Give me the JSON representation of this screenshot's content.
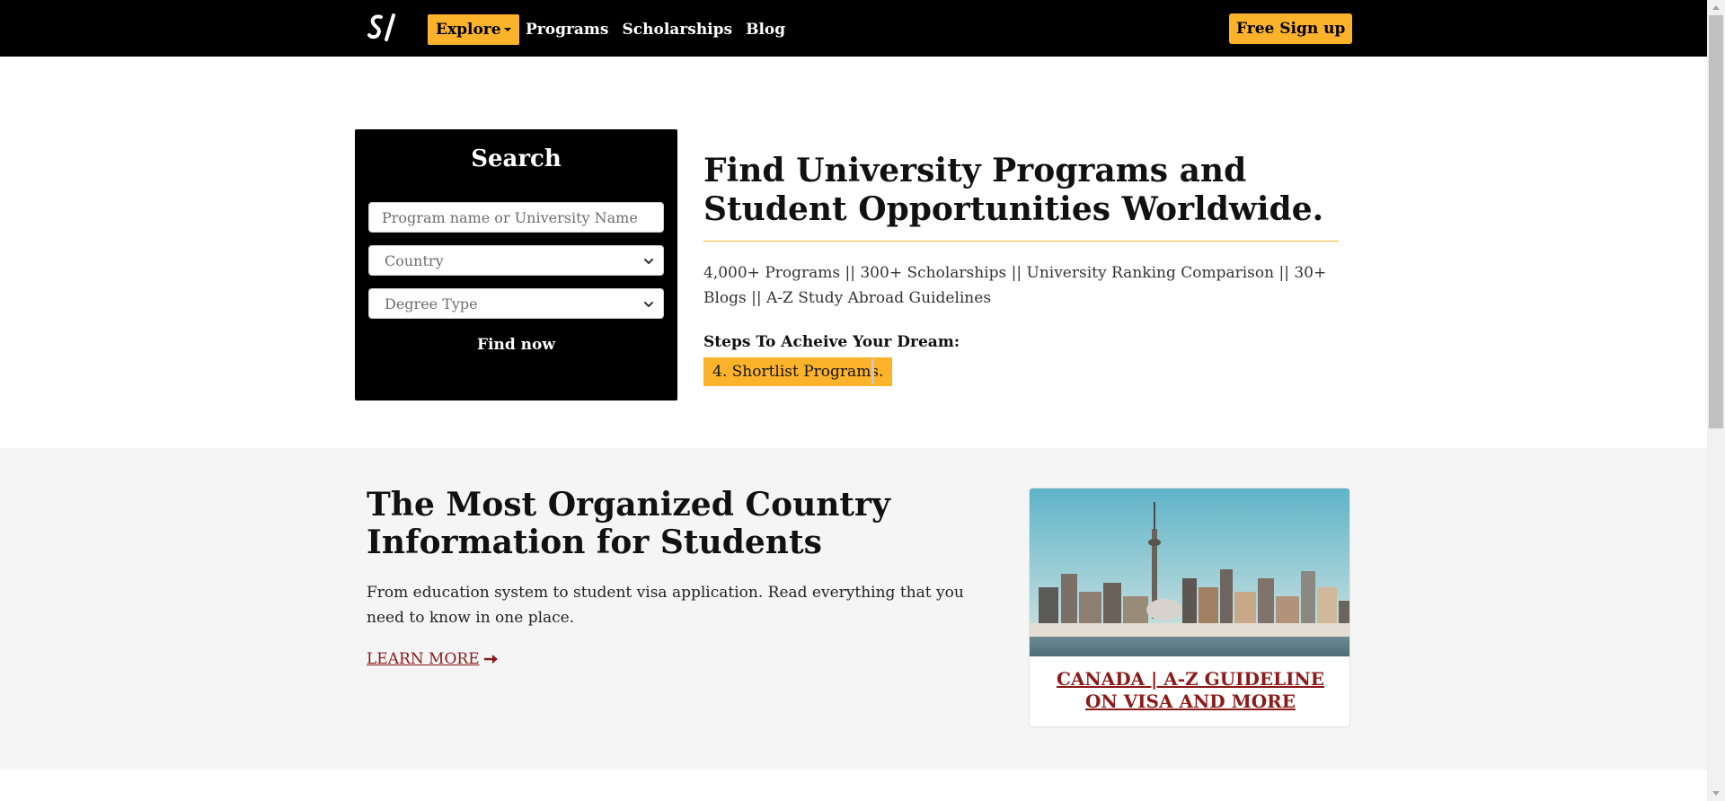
{
  "navbar": {
    "brand": "SI",
    "explore_label": "Explore",
    "links": [
      "Programs",
      "Scholarships",
      "Blog"
    ],
    "signup_label": "Free Sign up"
  },
  "search": {
    "title": "Search",
    "program_placeholder": "Program name or University Name",
    "country_value": "Country",
    "degree_value": "Degree Type",
    "find_label": "Find now"
  },
  "hero": {
    "title": "Find University Programs and Student Opportunities Worldwide.",
    "stats": "4,000+ Programs || 300+ Scholarships || University Ranking Comparison || 30+ Blogs || A-Z Study Abroad Guidelines",
    "steps_label": "Steps To Acheive Your Dream:",
    "current_step": "4. Shortlist Programs."
  },
  "country_section": {
    "title": "The Most Organized Country Information for Students",
    "description": "From education system to student visa application. Read everything that you need to know in one place.",
    "learn_more": "LEARN MORE",
    "card_title": "CANADA | A-Z GUIDELINE ON VISA AND MORE"
  },
  "colors": {
    "accent": "#fcb32b",
    "navbar_bg": "#000000",
    "link_red": "#8b1a1a",
    "section_bg": "#f5f5f5"
  }
}
